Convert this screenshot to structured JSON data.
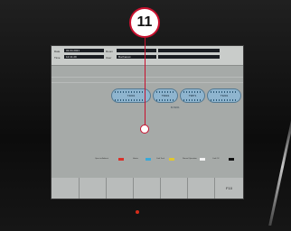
{
  "callout": {
    "number": "11",
    "color": "#c8102e"
  },
  "screen": {
    "header": {
      "date_label": "Date",
      "date_value": "03.04.2021",
      "time_label": "Time",
      "time_value": "12:41:29",
      "row3_label": "Room",
      "row3_value": "",
      "user_label": "User",
      "user_value": "Bucharest"
    },
    "stations": [
      "T4001",
      "T9901",
      "T9871",
      "T3201"
    ],
    "center_label": "B-5201",
    "legend": [
      {
        "label": "Open to Ambient",
        "color": "#d9322a"
      },
      {
        "label": "Heater",
        "color": "#3aa9d8"
      },
      {
        "label": "Cool Tank",
        "color": "#e0c630"
      },
      {
        "label": "Normal Operation",
        "color": "#f2f2f2"
      },
      {
        "label": "Cool Off",
        "color": "#111111"
      }
    ],
    "function_keys": [
      "",
      "",
      "",
      "",
      "",
      "",
      "F10"
    ]
  }
}
